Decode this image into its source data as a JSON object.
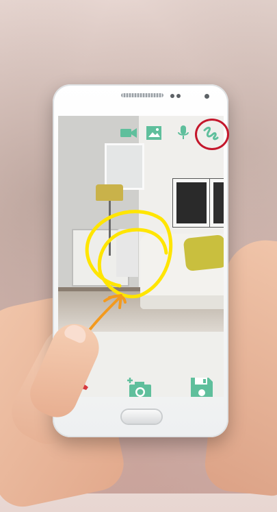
{
  "colors": {
    "accent": "#5fbf9c",
    "end_call": "#d6393f",
    "highlight_circle": "#c4172c",
    "sketch_yellow": "#ffe500",
    "sketch_orange": "#f39a1e"
  },
  "toolbar": {
    "items": [
      {
        "icon": "video-camera-icon"
      },
      {
        "icon": "image-icon"
      },
      {
        "icon": "microphone-icon"
      },
      {
        "icon": "draw-scribble-icon",
        "selected": true
      }
    ]
  },
  "bottom_bar": {
    "items": [
      {
        "icon": "end-call-icon"
      },
      {
        "icon": "add-photo-camera-icon"
      },
      {
        "icon": "save-floppy-icon"
      }
    ]
  }
}
